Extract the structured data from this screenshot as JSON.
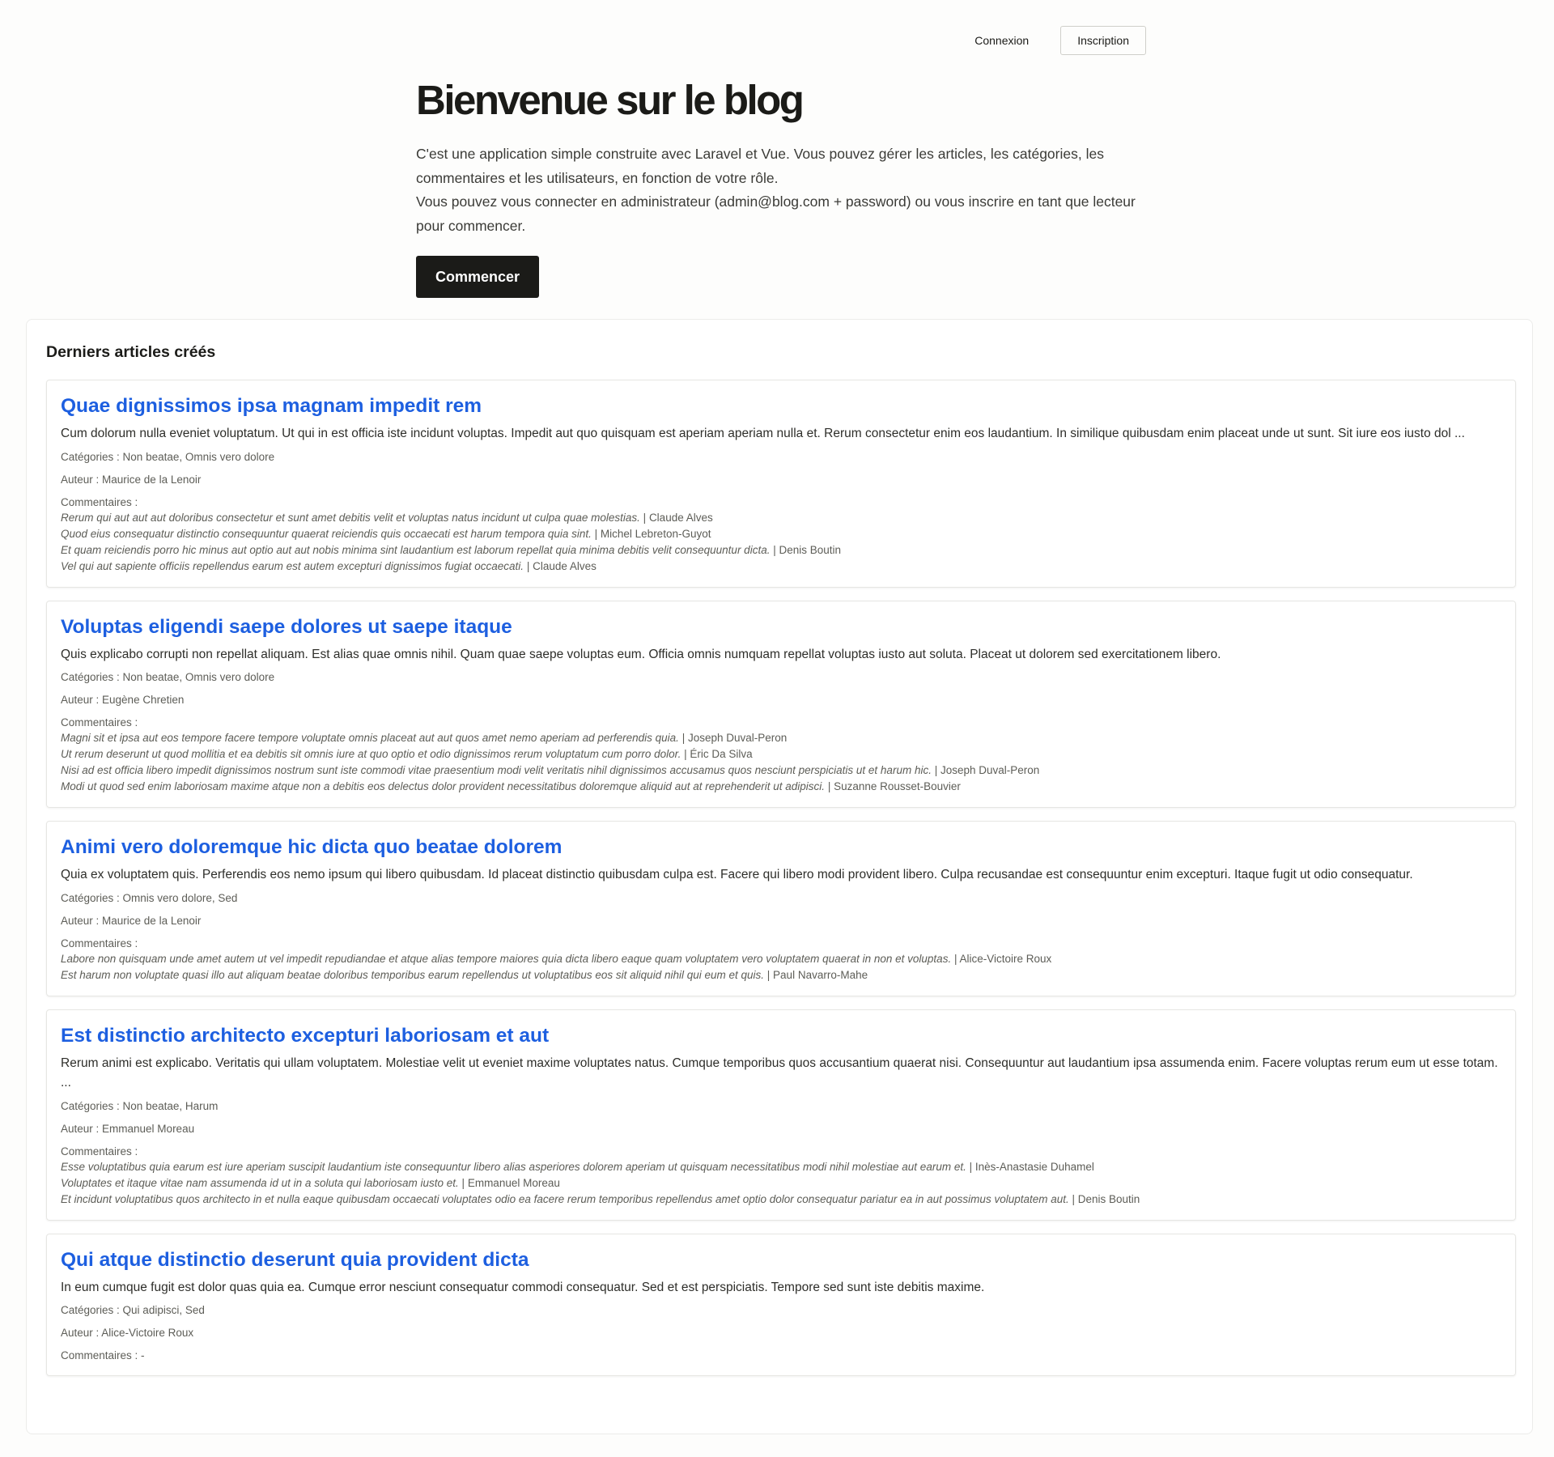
{
  "nav": {
    "login_label": "Connexion",
    "register_label": "Inscription"
  },
  "hero": {
    "title": "Bienvenue sur le blog",
    "intro_line1": "C'est une application simple construite avec Laravel et Vue. Vous pouvez gérer les articles, les catégories, les commentaires et les utilisateurs, en fonction de votre rôle.",
    "intro_line2": "Vous pouvez vous connecter en administrateur (admin@blog.com + password) ou vous inscrire en tant que lecteur pour commencer.",
    "cta_label": "Commencer"
  },
  "latest": {
    "heading": "Derniers articles créés",
    "categories_label": "Catégories : ",
    "author_label": "Auteur : ",
    "comments_label": "Commentaires :",
    "separator": " | ",
    "articles": [
      {
        "title": "Quae dignissimos ipsa magnam impedit rem",
        "body": "Cum dolorum nulla eveniet voluptatum. Ut qui in est officia iste incidunt voluptas. Impedit aut quo quisquam est aperiam aperiam nulla et. Rerum consectetur enim eos laudantium. In similique quibusdam enim placeat unde ut sunt. Sit iure eos iusto dol ...",
        "categories": "Non beatae, Omnis vero dolore",
        "author": "Maurice de la Lenoir",
        "comments": [
          {
            "text": "Rerum qui aut aut aut doloribus consectetur et sunt amet debitis velit et voluptas natus incidunt ut culpa quae molestias.",
            "author": "Claude Alves"
          },
          {
            "text": "Quod eius consequatur distinctio consequuntur quaerat reiciendis quis occaecati est harum tempora quia sint.",
            "author": "Michel Lebreton-Guyot"
          },
          {
            "text": "Et quam reiciendis porro hic minus aut optio aut aut nobis minima sint laudantium est laborum repellat quia minima debitis velit consequuntur dicta.",
            "author": "Denis Boutin"
          },
          {
            "text": "Vel qui aut sapiente officiis repellendus earum est autem excepturi dignissimos fugiat occaecati.",
            "author": "Claude Alves"
          }
        ]
      },
      {
        "title": "Voluptas eligendi saepe dolores ut saepe itaque",
        "body": "Quis explicabo corrupti non repellat aliquam. Est alias quae omnis nihil. Quam quae saepe voluptas eum. Officia omnis numquam repellat voluptas iusto aut soluta. Placeat ut dolorem sed exercitationem libero.",
        "categories": "Non beatae, Omnis vero dolore",
        "author": "Eugène Chretien",
        "comments": [
          {
            "text": "Magni sit et ipsa aut eos tempore facere tempore voluptate omnis placeat aut aut quos amet nemo aperiam ad perferendis quia.",
            "author": "Joseph Duval-Peron"
          },
          {
            "text": "Ut rerum deserunt ut quod mollitia et ea debitis sit omnis iure at quo optio et odio dignissimos rerum voluptatum cum porro dolor.",
            "author": "Éric Da Silva"
          },
          {
            "text": "Nisi ad est officia libero impedit dignissimos nostrum sunt iste commodi vitae praesentium modi velit veritatis nihil dignissimos accusamus quos nesciunt perspiciatis ut et harum hic.",
            "author": "Joseph Duval-Peron"
          },
          {
            "text": "Modi ut quod sed enim laboriosam maxime atque non a debitis eos delectus dolor provident necessitatibus doloremque aliquid aut at reprehenderit ut adipisci.",
            "author": "Suzanne Rousset-Bouvier"
          }
        ]
      },
      {
        "title": "Animi vero doloremque hic dicta quo beatae dolorem",
        "body": "Quia ex voluptatem quis. Perferendis eos nemo ipsum qui libero quibusdam. Id placeat distinctio quibusdam culpa est. Facere qui libero modi provident libero. Culpa recusandae est consequuntur enim excepturi. Itaque fugit ut odio consequatur.",
        "categories": "Omnis vero dolore, Sed",
        "author": "Maurice de la Lenoir",
        "comments": [
          {
            "text": "Labore non quisquam unde amet autem ut vel impedit repudiandae et atque alias tempore maiores quia dicta libero eaque quam voluptatem vero voluptatem quaerat in non et voluptas.",
            "author": "Alice-Victoire Roux"
          },
          {
            "text": "Est harum non voluptate quasi illo aut aliquam beatae doloribus temporibus earum repellendus ut voluptatibus eos sit aliquid nihil qui eum et quis.",
            "author": "Paul Navarro-Mahe"
          }
        ]
      },
      {
        "title": "Est distinctio architecto excepturi laboriosam et aut",
        "body": "Rerum animi est explicabo. Veritatis qui ullam voluptatem. Molestiae velit ut eveniet maxime voluptates natus. Cumque temporibus quos accusantium quaerat nisi. Consequuntur aut laudantium ipsa assumenda enim. Facere voluptas rerum eum ut esse totam.  ...",
        "categories": "Non beatae, Harum",
        "author": "Emmanuel Moreau",
        "comments": [
          {
            "text": "Esse voluptatibus quia earum est iure aperiam suscipit laudantium iste consequuntur libero alias asperiores dolorem aperiam ut quisquam necessitatibus modi nihil molestiae aut earum et.",
            "author": "Inès-Anastasie Duhamel"
          },
          {
            "text": "Voluptates et itaque vitae nam assumenda id ut in a soluta qui laboriosam iusto et.",
            "author": "Emmanuel Moreau"
          },
          {
            "text": "Et incidunt voluptatibus quos architecto in et nulla eaque quibusdam occaecati voluptates odio ea facere rerum temporibus repellendus amet optio dolor consequatur pariatur ea in aut possimus voluptatem aut.",
            "author": "Denis Boutin"
          }
        ]
      },
      {
        "title": "Qui atque distinctio deserunt quia provident dicta",
        "body": "In eum cumque fugit est dolor quas quia ea. Cumque error nesciunt consequatur commodi consequatur. Sed et est perspiciatis. Tempore sed sunt iste debitis maxime.",
        "categories": "Qui adipisci, Sed",
        "author": "Alice-Victoire Roux",
        "comments": [],
        "comments_empty": "Commentaires : -"
      }
    ]
  }
}
